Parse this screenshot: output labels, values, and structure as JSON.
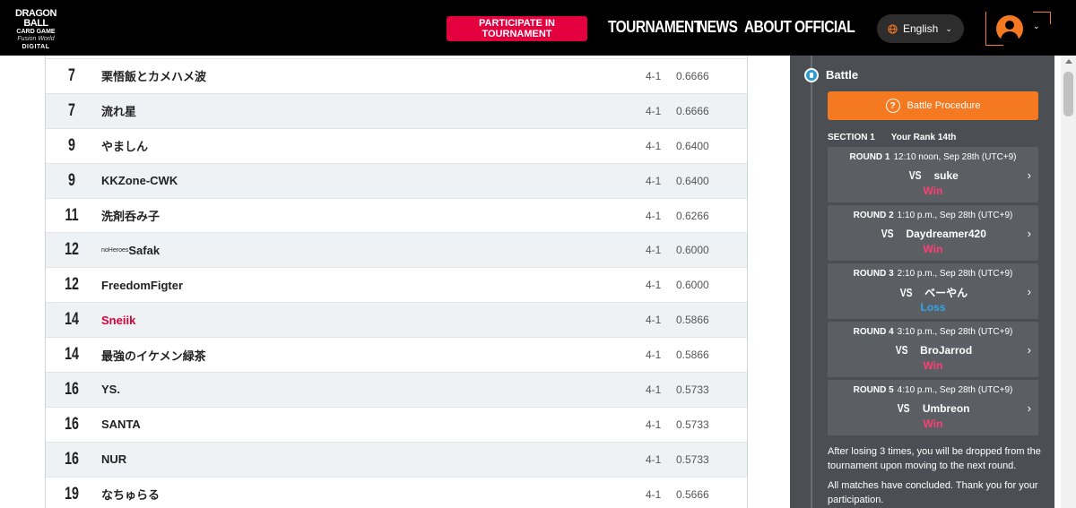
{
  "header": {
    "logo": {
      "line1": "DRAGON BALL",
      "line2": "CARD GAME",
      "line3": "Fusion World",
      "line4": "DIGITAL"
    },
    "participate_label": "PARTICIPATE IN TOURNAMENT",
    "nav": [
      "TOURNAMENT",
      "NEWS",
      "ABOUT",
      "OFFICIAL"
    ],
    "language": "English",
    "icons": {
      "language": "globe-icon",
      "avatar": "user-avatar-icon",
      "dropdown": "chevron-down-icon"
    }
  },
  "standings": [
    {
      "rank": "7",
      "prefix": "",
      "name": "栗悟飯とカメハメ波",
      "record": "4-1",
      "score": "0.6666",
      "me": false
    },
    {
      "rank": "7",
      "prefix": "",
      "name": "流れ星",
      "record": "4-1",
      "score": "0.6666",
      "me": false
    },
    {
      "rank": "9",
      "prefix": "",
      "name": "やましん",
      "record": "4-1",
      "score": "0.6400",
      "me": false
    },
    {
      "rank": "9",
      "prefix": "",
      "name": "KKZone-CWK",
      "record": "4-1",
      "score": "0.6400",
      "me": false
    },
    {
      "rank": "11",
      "prefix": "",
      "name": "洗剤呑み子",
      "record": "4-1",
      "score": "0.6266",
      "me": false
    },
    {
      "rank": "12",
      "prefix": "noHeroes",
      "name": "Safak",
      "record": "4-1",
      "score": "0.6000",
      "me": false
    },
    {
      "rank": "12",
      "prefix": "",
      "name": "FreedomFigter",
      "record": "4-1",
      "score": "0.6000",
      "me": false
    },
    {
      "rank": "14",
      "prefix": "",
      "name": "Sneiik",
      "record": "4-1",
      "score": "0.5866",
      "me": true
    },
    {
      "rank": "14",
      "prefix": "",
      "name": "最強のイケメン緑茶",
      "record": "4-1",
      "score": "0.5866",
      "me": false
    },
    {
      "rank": "16",
      "prefix": "",
      "name": "YS.",
      "record": "4-1",
      "score": "0.5733",
      "me": false
    },
    {
      "rank": "16",
      "prefix": "",
      "name": "SANTA",
      "record": "4-1",
      "score": "0.5733",
      "me": false
    },
    {
      "rank": "16",
      "prefix": "",
      "name": "NUR",
      "record": "4-1",
      "score": "0.5733",
      "me": false
    },
    {
      "rank": "19",
      "prefix": "",
      "name": "なちゅらる",
      "record": "4-1",
      "score": "0.5666",
      "me": false
    }
  ],
  "battle": {
    "title": "Battle",
    "procedure_label": "Battle Procedure",
    "section": "SECTION 1",
    "your_rank": "Your Rank 14th",
    "vs_label": "VS",
    "rounds": [
      {
        "label": "ROUND 1",
        "time": "12:10 noon, Sep 28th (UTC+9)",
        "opponent": "suke",
        "result": "Win"
      },
      {
        "label": "ROUND 2",
        "time": "1:10 p.m., Sep 28th (UTC+9)",
        "opponent": "Daydreamer420",
        "result": "Win"
      },
      {
        "label": "ROUND 3",
        "time": "2:10 p.m., Sep 28th (UTC+9)",
        "opponent": "ベーやん",
        "result": "Loss"
      },
      {
        "label": "ROUND 4",
        "time": "3:10 p.m., Sep 28th (UTC+9)",
        "opponent": "BroJarrod",
        "result": "Win"
      },
      {
        "label": "ROUND 5",
        "time": "4:10 p.m., Sep 28th (UTC+9)",
        "opponent": "Umbreon",
        "result": "Win"
      }
    ],
    "note_drop": "After losing 3 times, you will be dropped from the tournament upon moving to the next round.",
    "note_done": "All matches have concluded. Thank you for your participation."
  },
  "colors": {
    "accent_red": "#e4003f",
    "accent_orange": "#f47920",
    "win": "#ff3e73",
    "loss": "#2ea6e8",
    "panel": "#4b4f54"
  }
}
